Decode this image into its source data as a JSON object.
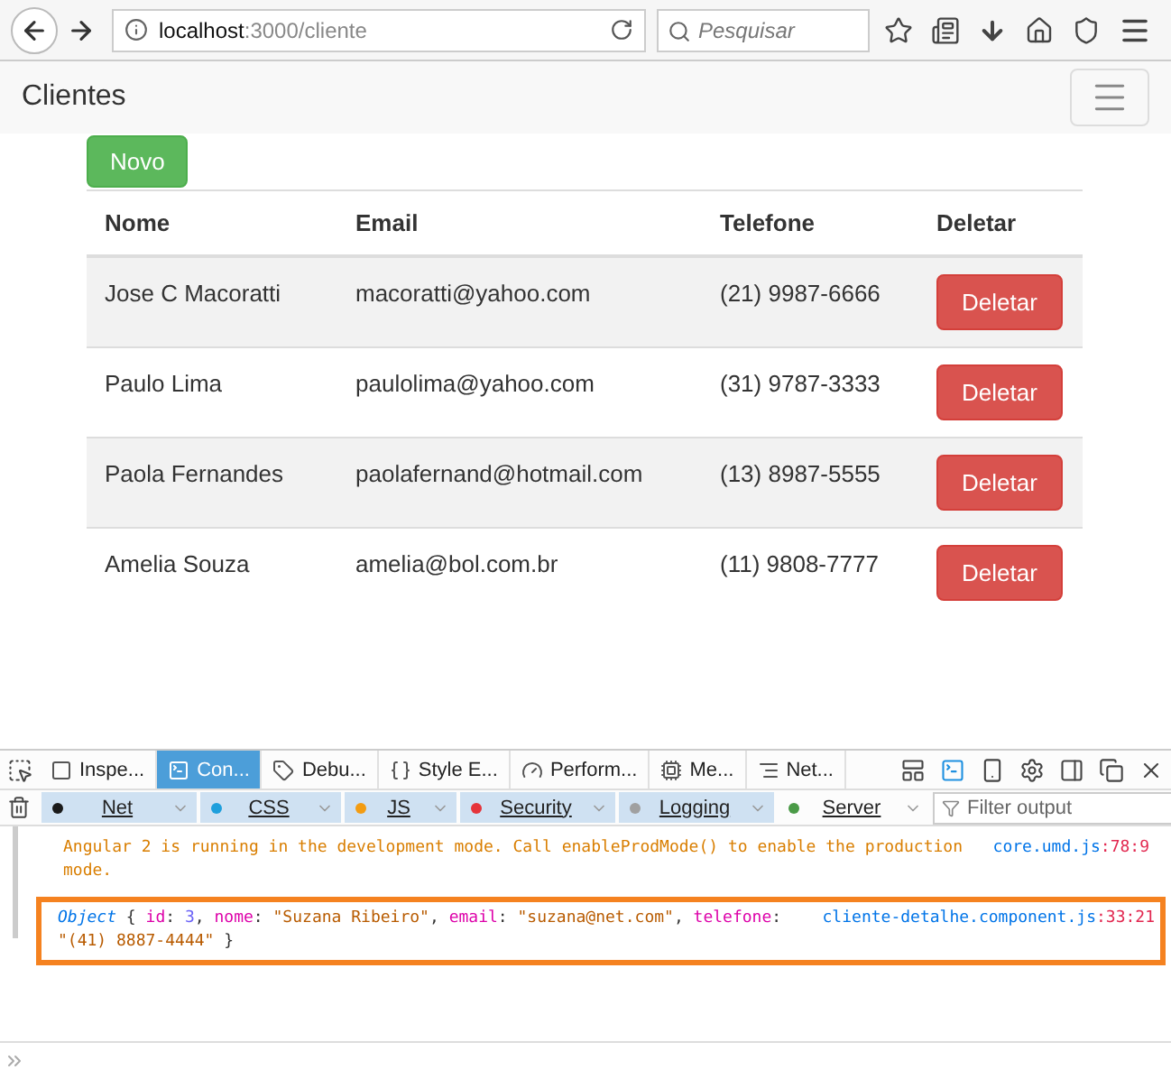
{
  "browser": {
    "url_host": "localhost",
    "url_path": ":3000/cliente",
    "search_placeholder": "Pesquisar"
  },
  "navbar": {
    "brand": "Clientes"
  },
  "new_button": "Novo",
  "table": {
    "columns": [
      "Nome",
      "Email",
      "Telefone",
      "Deletar"
    ],
    "rows": [
      {
        "name": "Jose C Macoratti",
        "email": "macoratti@yahoo.com",
        "phone": "(21) 9987-6666",
        "action": "Deletar"
      },
      {
        "name": "Paulo Lima",
        "email": "paulolima@yahoo.com",
        "phone": "(31) 9787-3333",
        "action": "Deletar"
      },
      {
        "name": "Paola Fernandes",
        "email": "paolafernand@hotmail.com",
        "phone": "(13) 8987-5555",
        "action": "Deletar"
      },
      {
        "name": "Amelia Souza",
        "email": "amelia@bol.com.br",
        "phone": "(11) 9808-7777",
        "action": "Deletar"
      }
    ]
  },
  "devtools": {
    "tabs": [
      {
        "label": "Inspe...",
        "selected": false
      },
      {
        "label": "Con...",
        "selected": true
      },
      {
        "label": "Debu...",
        "selected": false
      },
      {
        "label": "Style E...",
        "selected": false
      },
      {
        "label": "Perform...",
        "selected": false
      },
      {
        "label": "Me...",
        "selected": false
      },
      {
        "label": "Net...",
        "selected": false
      }
    ],
    "filters": [
      {
        "label": "Net",
        "color": "#1a1a1a",
        "selected": true
      },
      {
        "label": "CSS",
        "color": "#1e9fdc",
        "selected": true
      },
      {
        "label": "JS",
        "color": "#f39c12",
        "selected": true
      },
      {
        "label": "Security",
        "color": "#e5343a",
        "selected": true
      },
      {
        "label": "Logging",
        "color": "#a0a0a0",
        "selected": true
      },
      {
        "label": "Server",
        "color": "#4a9a47",
        "selected": false
      }
    ],
    "filter_placeholder": "Filter output",
    "messages": [
      {
        "kind": "warning",
        "text": "Angular 2 is running in the development mode. Call enableProdMode() to enable the production mode.",
        "source": "core.umd.js",
        "location": ":78:9",
        "highlighted": false
      },
      {
        "kind": "object",
        "tokens": [
          {
            "kind": "type",
            "text": "Object"
          },
          {
            "kind": "punct",
            "text": " { "
          },
          {
            "kind": "key",
            "text": "id"
          },
          {
            "kind": "punct",
            "text": ": "
          },
          {
            "kind": "number",
            "text": "3"
          },
          {
            "kind": "punct",
            "text": ", "
          },
          {
            "kind": "key",
            "text": "nome"
          },
          {
            "kind": "punct",
            "text": ": "
          },
          {
            "kind": "string",
            "text": "\"Suzana Ribeiro\""
          },
          {
            "kind": "punct",
            "text": ", "
          },
          {
            "kind": "key",
            "text": "email"
          },
          {
            "kind": "punct",
            "text": ": "
          },
          {
            "kind": "string",
            "text": "\"suzana@net.com\""
          },
          {
            "kind": "punct",
            "text": ", "
          },
          {
            "kind": "key",
            "text": "telefone"
          },
          {
            "kind": "punct",
            "text": ": "
          },
          {
            "kind": "string",
            "text": "\"(41) 8887-4444\""
          },
          {
            "kind": "punct",
            "text": " }"
          }
        ],
        "source": "cliente-detalhe.component.js",
        "location": ":33:21",
        "highlighted": true
      }
    ]
  }
}
